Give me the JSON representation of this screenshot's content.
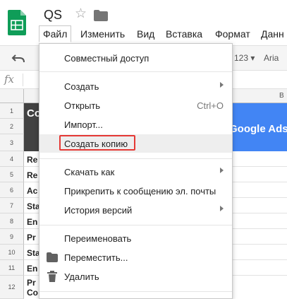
{
  "app": {
    "doc_title": "QS",
    "icons": {
      "logo": "google-sheets-logo",
      "star": "star-icon",
      "folder": "folder-icon"
    }
  },
  "menubar": {
    "items": [
      "Файл",
      "Изменить",
      "Вид",
      "Вставка",
      "Формат",
      "Данн"
    ],
    "active_index": 0
  },
  "toolbar": {
    "number_format": "123",
    "font_family": "Aria"
  },
  "formula_bar": {
    "fx": "fx"
  },
  "grid": {
    "column_letter": "B",
    "rows": [
      "1",
      "2",
      "3",
      "4",
      "5",
      "6",
      "7",
      "8",
      "9",
      "10",
      "11",
      "12"
    ],
    "header_dark_text": "Co",
    "header_blue_text": "Google Ads",
    "fragments": [
      "Re",
      "Re",
      "Ac",
      "Sta",
      "En",
      "Pr",
      "Sta",
      "En",
      "Pr",
      "Co"
    ]
  },
  "file_menu": {
    "items": {
      "share": "Совместный доступ",
      "create": "Создать",
      "open": "Открыть",
      "open_shortcut": "Ctrl+O",
      "import": "Импорт...",
      "make_copy": "Создать копию",
      "download": "Скачать как",
      "email_attach": "Прикрепить к сообщению эл. почты",
      "version_history": "История версий",
      "rename": "Переименовать",
      "move": "Переместить...",
      "delete": "Удалить"
    },
    "highlighted_item": "make_copy",
    "highlight_frame_color": "#e53935"
  },
  "colors": {
    "sheets_green": "#0f9d58",
    "header_dark": "#424242",
    "header_blue": "#4285f4"
  }
}
